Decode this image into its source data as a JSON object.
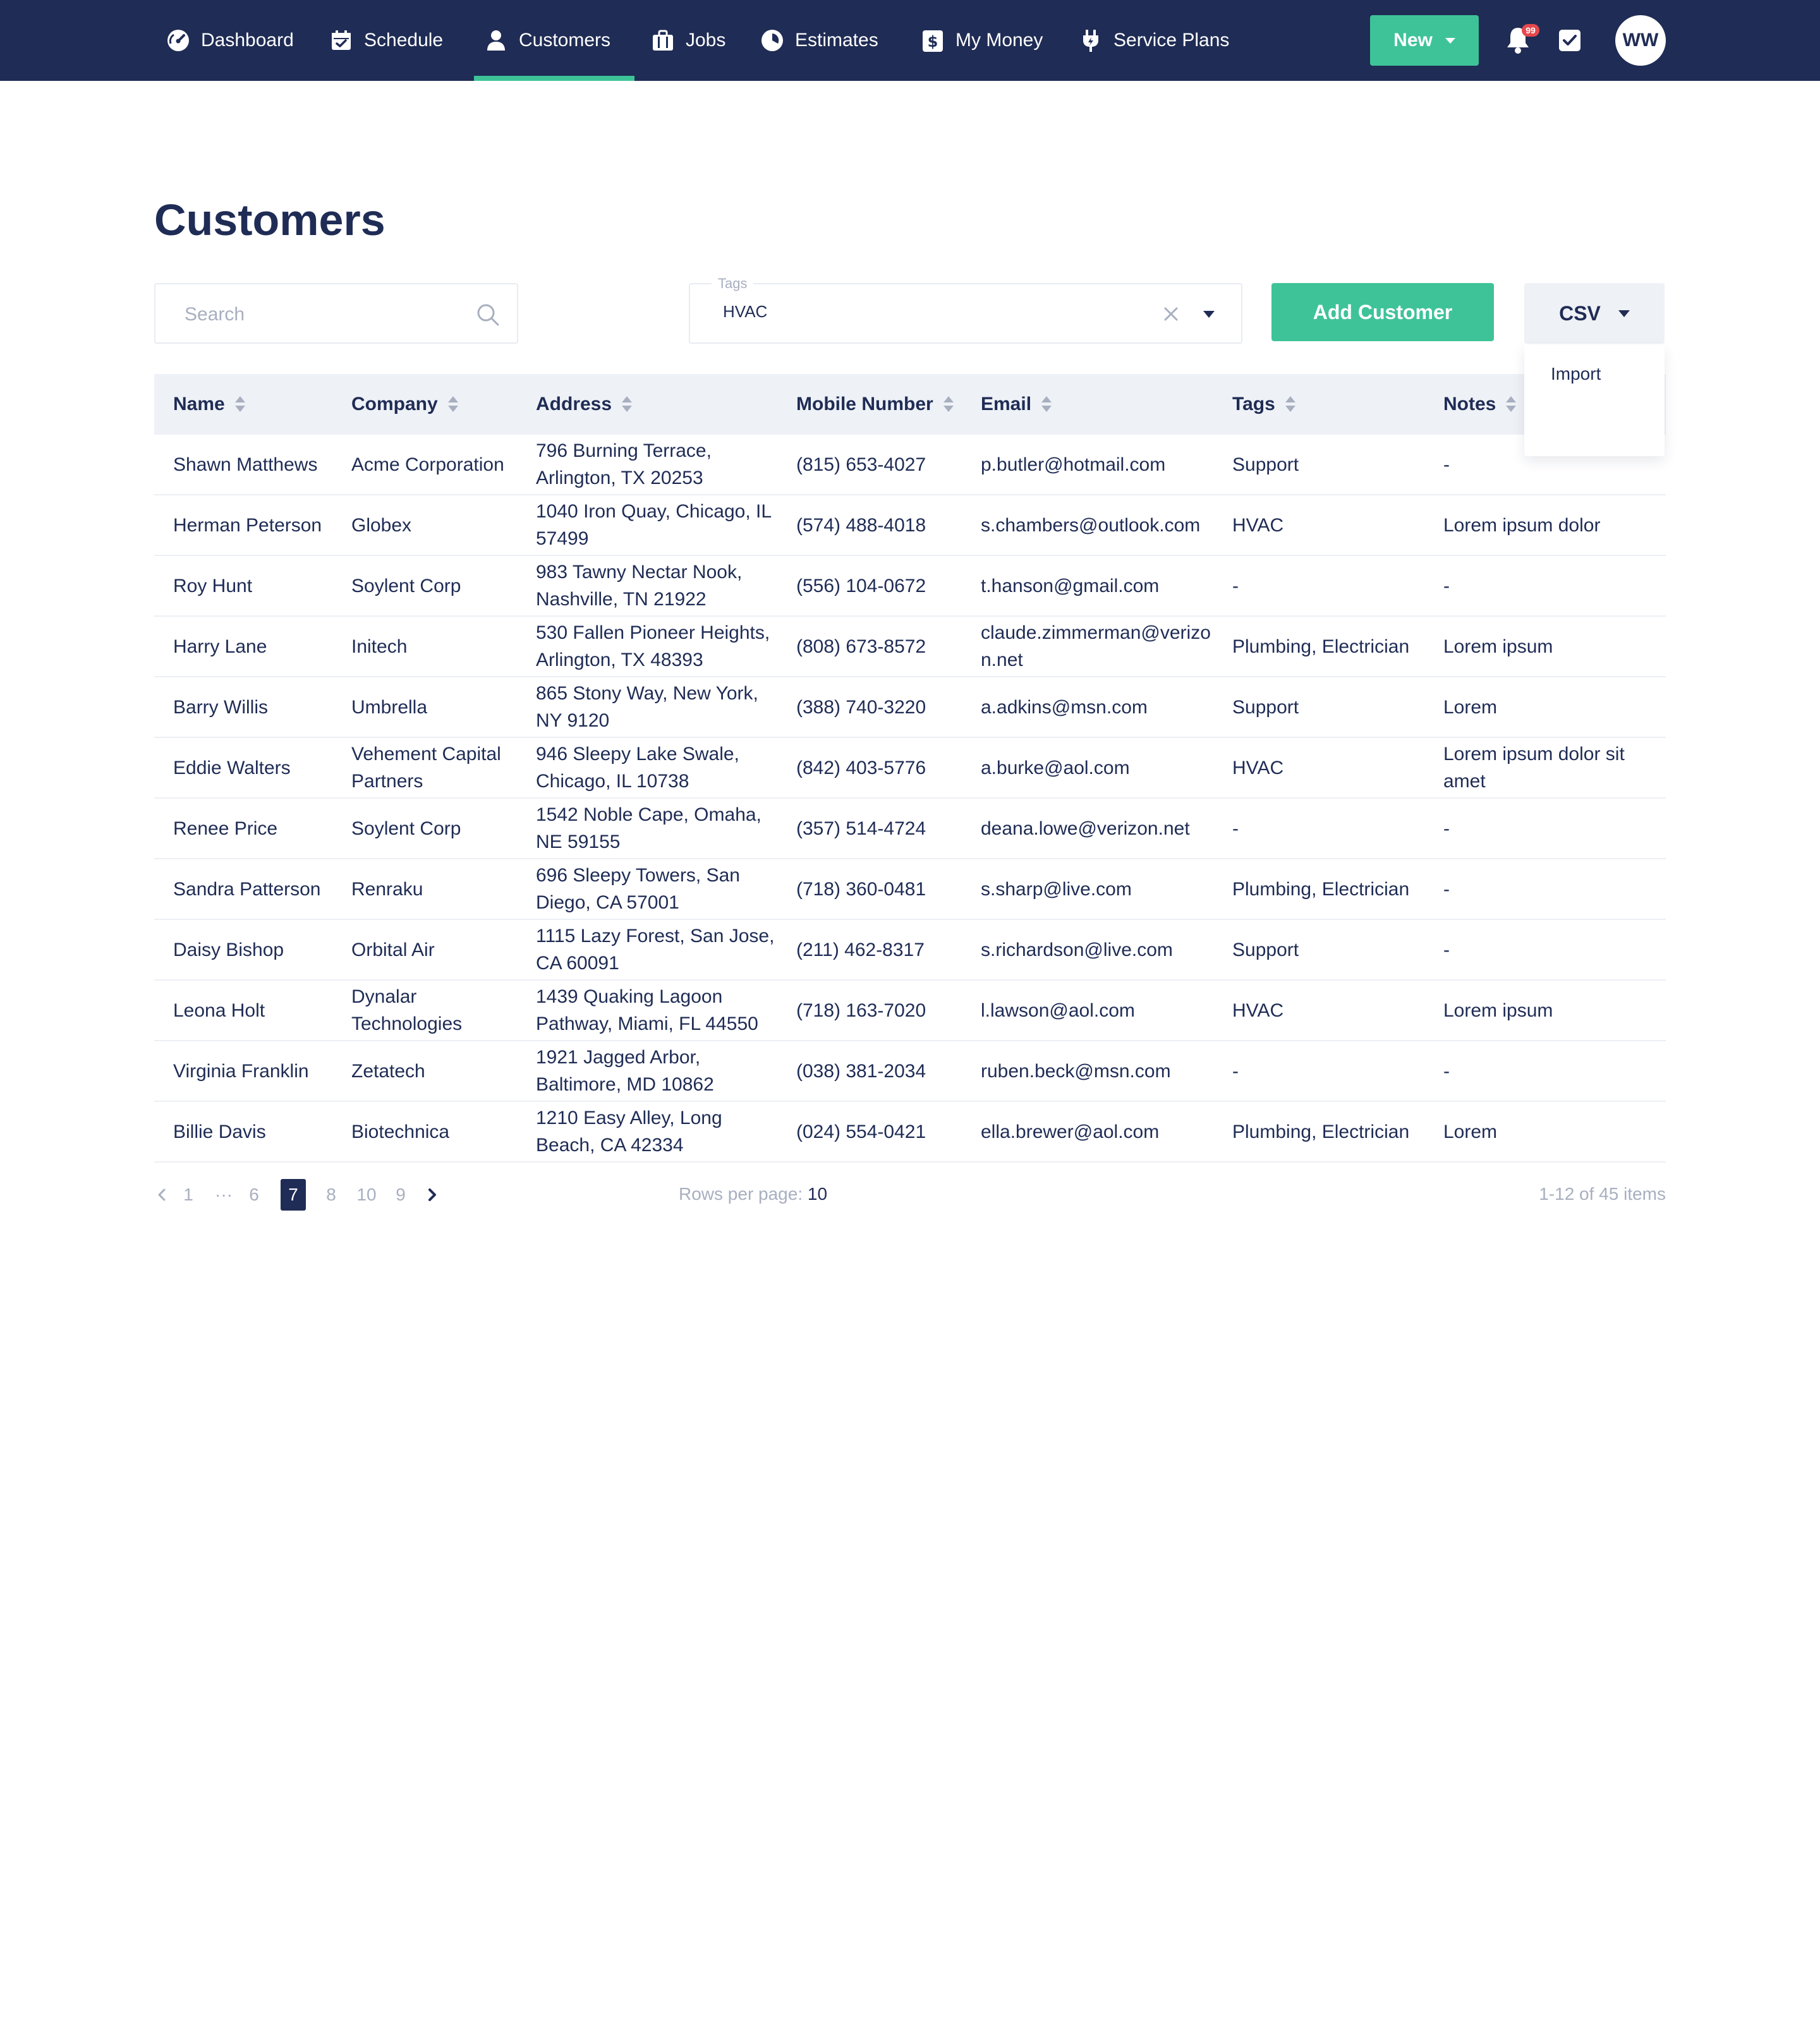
{
  "nav": {
    "items": [
      {
        "label": "Dashboard",
        "icon": "dashboard-gauge-icon"
      },
      {
        "label": "Schedule",
        "icon": "calendar-icon"
      },
      {
        "label": "Customers",
        "icon": "user-icon",
        "active": true
      },
      {
        "label": "Jobs",
        "icon": "briefcase-icon"
      },
      {
        "label": "Estimates",
        "icon": "pie-chart-icon"
      },
      {
        "label": "My Money",
        "icon": "dollar-icon"
      },
      {
        "label": "Service Plans",
        "icon": "plug-icon"
      }
    ],
    "new_label": "New",
    "notification_count": "99",
    "avatar_initials": "WW"
  },
  "page": {
    "title": "Customers"
  },
  "filters": {
    "search_placeholder": "Search",
    "tags_label": "Tags",
    "tags_value": "HVAC",
    "add_customer_label": "Add Customer",
    "csv_label": "CSV",
    "csv_menu_option": "Import"
  },
  "table": {
    "columns": [
      "Name",
      "Company",
      "Address",
      "Mobile Number",
      "Email",
      "Tags",
      "Notes"
    ],
    "rows": [
      {
        "name": "Shawn Matthews",
        "company": "Acme Corporation",
        "address": "796 Burning Terrace, Arlington, TX 20253",
        "mobile": "(815) 653-4027",
        "email": "p.butler@hotmail.com",
        "tags": "Support",
        "notes": "-"
      },
      {
        "name": "Herman Peterson",
        "company": "Globex",
        "address": "1040 Iron Quay, Chicago, IL 57499",
        "mobile": "(574) 488-4018",
        "email": "s.chambers@outlook.com",
        "tags": "HVAC",
        "notes": "Lorem ipsum dolor"
      },
      {
        "name": "Roy Hunt",
        "company": "Soylent Corp",
        "address": "983 Tawny Nectar Nook, Nashville, TN 21922",
        "mobile": "(556) 104-0672",
        "email": "t.hanson@gmail.com",
        "tags": "-",
        "notes": "-"
      },
      {
        "name": "Harry Lane",
        "company": "Initech",
        "address": "530 Fallen Pioneer Heights, Arlington, TX 48393",
        "mobile": "(808) 673-8572",
        "email": "claude.zimmerman@verizon.net",
        "tags": "Plumbing, Electrician",
        "notes": "Lorem ipsum"
      },
      {
        "name": "Barry Willis",
        "company": "Umbrella",
        "address": "865 Stony Way, New York, NY 9120",
        "mobile": "(388) 740-3220",
        "email": "a.adkins@msn.com",
        "tags": "Support",
        "notes": "Lorem"
      },
      {
        "name": "Eddie Walters",
        "company": "Vehement Capital Partners",
        "address": "946 Sleepy Lake Swale, Chicago, IL 10738",
        "mobile": "(842) 403-5776",
        "email": "a.burke@aol.com",
        "tags": "HVAC",
        "notes": "Lorem ipsum dolor sit amet"
      },
      {
        "name": "Renee Price",
        "company": "Soylent Corp",
        "address": "1542 Noble Cape, Omaha, NE 59155",
        "mobile": "(357) 514-4724",
        "email": "deana.lowe@verizon.net",
        "tags": "-",
        "notes": "-"
      },
      {
        "name": "Sandra Patterson",
        "company": "Renraku",
        "address": "696 Sleepy Towers, San Diego, CA 57001",
        "mobile": "(718) 360-0481",
        "email": "s.sharp@live.com",
        "tags": "Plumbing, Electrician",
        "notes": "-"
      },
      {
        "name": "Daisy Bishop",
        "company": "Orbital Air",
        "address": "1115 Lazy Forest, San Jose, CA 60091",
        "mobile": "(211) 462-8317",
        "email": "s.richardson@live.com",
        "tags": "Support",
        "notes": "-"
      },
      {
        "name": "Leona Holt",
        "company": "Dynalar Technologies",
        "address": "1439 Quaking Lagoon Pathway, Miami, FL 44550",
        "mobile": "(718) 163-7020",
        "email": "l.lawson@aol.com",
        "tags": "HVAC",
        "notes": "Lorem ipsum"
      },
      {
        "name": "Virginia Franklin",
        "company": "Zetatech",
        "address": "1921 Jagged Arbor, Baltimore, MD 10862",
        "mobile": "(038) 381-2034",
        "email": "ruben.beck@msn.com",
        "tags": "-",
        "notes": "-"
      },
      {
        "name": "Billie Davis",
        "company": "Biotechnica",
        "address": "1210 Easy Alley, Long Beach, CA 42334",
        "mobile": "(024) 554-0421",
        "email": "ella.brewer@aol.com",
        "tags": "Plumbing, Electrician",
        "notes": "Lorem"
      }
    ]
  },
  "pagination": {
    "pages": [
      "1",
      "···",
      "6",
      "7",
      "8",
      "10",
      "9"
    ],
    "current": "7",
    "rows_per_page_label": "Rows per page:",
    "rows_per_page_value": "10",
    "items_summary": "1-12 of 45 items"
  },
  "colors": {
    "navy": "#1f2c55",
    "accent_green": "#3ec399",
    "header_bg": "#eef1f6",
    "muted_text": "#a8afc0",
    "badge_red": "#e5484d"
  }
}
